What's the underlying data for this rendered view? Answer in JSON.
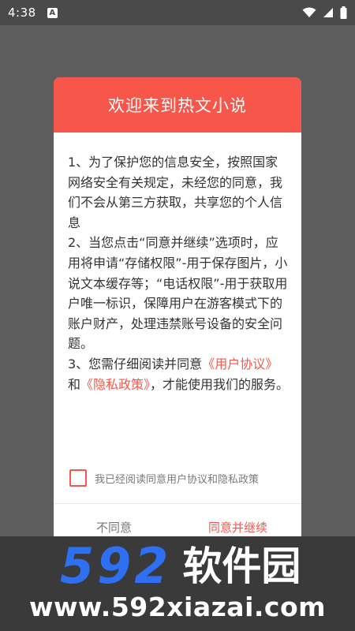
{
  "status_bar": {
    "time": "4:38",
    "notification_icon": "a-icon",
    "icons": [
      "wifi-icon",
      "signal-icon",
      "battery-icon"
    ]
  },
  "dialog": {
    "title": "欢迎来到热文小说",
    "paragraphs": {
      "p1": "1、为了保护您的信息安全，按照国家网络安全有关规定，未经您的同意，我们不会从第三方获取，共享您的个人信息",
      "p2": "2、当您点击“同意并继续”选项时，应用将申请“存储权限”-用于保存图片，小说文本缓存等；“电话权限”-用于获取用户唯一标识，保障用户在游客模式下的账户财产，处理违禁账号设备的安全问题。",
      "p3_prefix": "3、您需仔细阅读并同意",
      "p3_link_agreement": "《用户协议》",
      "p3_and": "和",
      "p3_link_privacy": "《隐私政策》",
      "p3_suffix": "，才能使用我们的服务。"
    },
    "consent_label": "我已经阅读同意用户协议和隐私政策",
    "consent_checked": false,
    "disagree_label": "不同意",
    "agree_label": "同意并继续"
  },
  "watermark": {
    "logo_digits": "592",
    "logo_text": "软件园",
    "url": "www.592xiazai.com"
  },
  "colors": {
    "accent": "#f7574a",
    "overlay": "#5d5d5d",
    "logo_blue": "#2f6ff2"
  }
}
